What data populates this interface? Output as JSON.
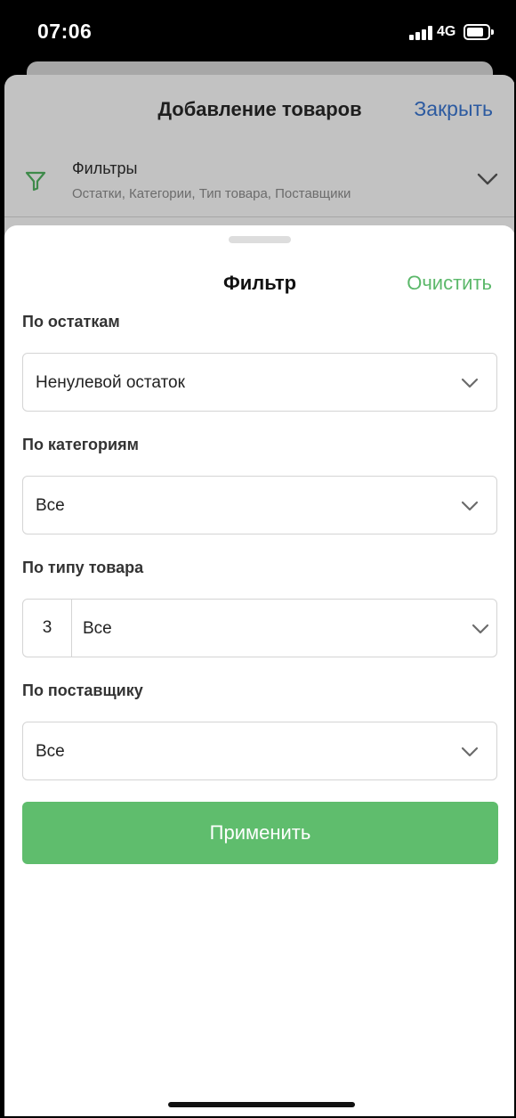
{
  "status_bar": {
    "time": "07:06",
    "network": "4G",
    "signal_bars": 4,
    "battery_level": 0.7
  },
  "background_screen": {
    "title": "Добавление товаров",
    "close_label": "Закрыть",
    "filters": {
      "icon": "filter-icon",
      "title": "Фильтры",
      "subtitle": "Остатки, Категории, Тип товара, Поставщики"
    }
  },
  "filter_sheet": {
    "title": "Фильтр",
    "clear_label": "Очистить",
    "sections": {
      "stock": {
        "label": "По остаткам",
        "value": "Ненулевой остаток"
      },
      "categories": {
        "label": "По категориям",
        "value": "Все"
      },
      "product_type": {
        "label": "По типу товара",
        "count": "3",
        "value": "Все"
      },
      "supplier": {
        "label": "По поставщику",
        "value": "Все"
      }
    },
    "apply_label": "Применить"
  },
  "colors": {
    "accent_green": "#5fbd6d",
    "link_blue": "#2c5aa0",
    "overlay_gray": "#c2c2c2",
    "filter_icon_green": "#3e8a4a"
  }
}
